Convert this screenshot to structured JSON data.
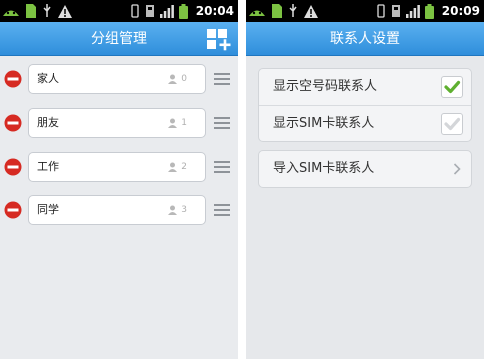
{
  "left_screen": {
    "status_bar": {
      "time": "20:04"
    },
    "title": "分组管理",
    "groups": [
      {
        "name": "家人",
        "count": "0"
      },
      {
        "name": "朋友",
        "count": "1"
      },
      {
        "name": "工作",
        "count": "2"
      },
      {
        "name": "同学",
        "count": "3"
      }
    ],
    "icons": {
      "header_action": "add-group-icon",
      "remove": "remove-icon",
      "drag": "drag-handle-icon",
      "member": "person-icon"
    }
  },
  "right_screen": {
    "status_bar": {
      "time": "20:09"
    },
    "title": "联系人设置",
    "settings": [
      {
        "label": "显示空号码联系人",
        "checked": true
      },
      {
        "label": "显示SIM卡联系人",
        "checked": false
      }
    ],
    "import_item": {
      "label": "导入SIM卡联系人"
    }
  },
  "colors": {
    "title_bar": "#3a9ae3",
    "remove_button": "#d62a22",
    "checkmark": "#5fb030"
  }
}
